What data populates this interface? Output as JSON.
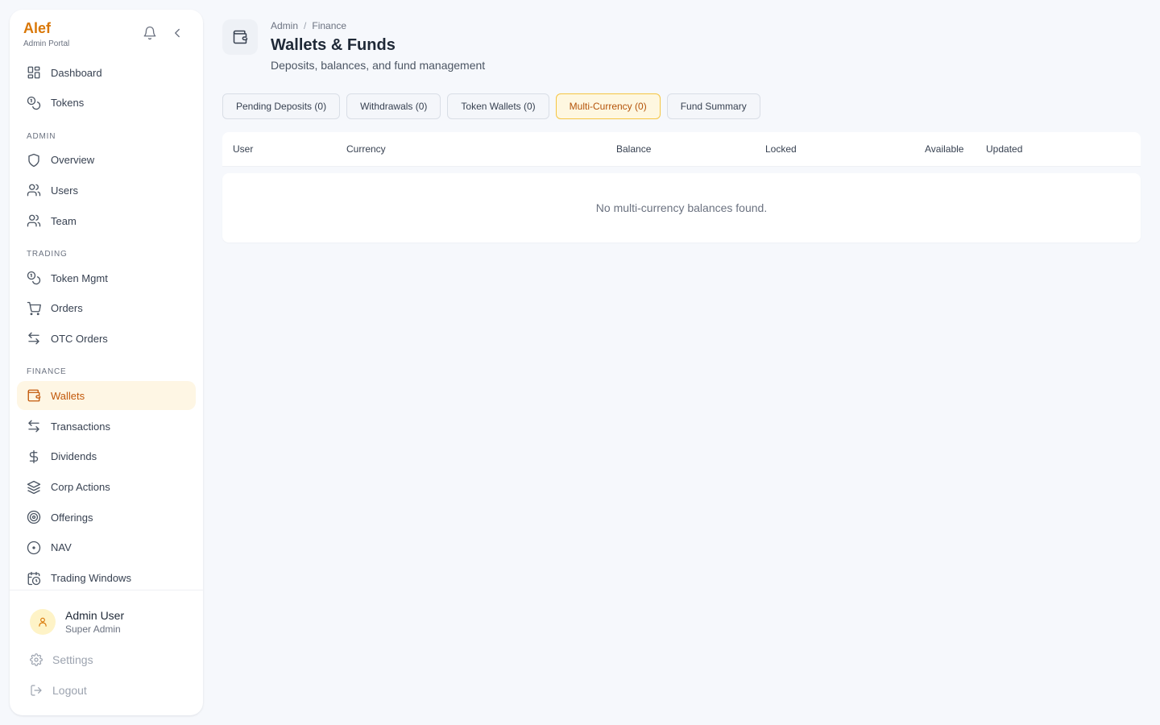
{
  "brand": {
    "name": "Alef",
    "subtitle": "Admin Portal"
  },
  "top_icons": {
    "notifications": "bell-icon",
    "collapse": "chevron-left-icon"
  },
  "nav": {
    "main": [
      {
        "label": "Dashboard",
        "icon": "dashboard-icon"
      },
      {
        "label": "Tokens",
        "icon": "coins-icon"
      }
    ],
    "sections": [
      {
        "label": "ADMIN",
        "items": [
          {
            "label": "Overview",
            "icon": "shield-icon"
          },
          {
            "label": "Users",
            "icon": "users-icon"
          },
          {
            "label": "Team",
            "icon": "team-icon"
          }
        ]
      },
      {
        "label": "TRADING",
        "items": [
          {
            "label": "Token Mgmt",
            "icon": "coins-icon"
          },
          {
            "label": "Orders",
            "icon": "cart-icon"
          },
          {
            "label": "OTC Orders",
            "icon": "arrows-icon"
          }
        ]
      },
      {
        "label": "FINANCE",
        "items": [
          {
            "label": "Wallets",
            "icon": "wallet-icon",
            "active": true
          },
          {
            "label": "Transactions",
            "icon": "arrows-icon"
          },
          {
            "label": "Dividends",
            "icon": "dollar-icon"
          },
          {
            "label": "Corp Actions",
            "icon": "layers-icon"
          },
          {
            "label": "Offerings",
            "icon": "target-icon"
          },
          {
            "label": "NAV",
            "icon": "circle-dot-icon"
          },
          {
            "label": "Trading Windows",
            "icon": "calendar-clock-icon"
          }
        ]
      }
    ]
  },
  "user": {
    "name": "Admin User",
    "role": "Super Admin"
  },
  "footer": {
    "settings": "Settings",
    "logout": "Logout"
  },
  "header": {
    "breadcrumb": [
      "Admin",
      "Finance"
    ],
    "title": "Wallets & Funds",
    "subtitle": "Deposits, balances, and fund management"
  },
  "tabs": [
    {
      "label": "Pending Deposits (0)"
    },
    {
      "label": "Withdrawals (0)"
    },
    {
      "label": "Token Wallets (0)"
    },
    {
      "label": "Multi-Currency (0)",
      "active": true
    },
    {
      "label": "Fund Summary"
    }
  ],
  "table": {
    "columns": [
      "User",
      "Currency",
      "Balance",
      "Locked",
      "Available",
      "Updated"
    ],
    "empty_message": "No multi-currency balances found."
  },
  "colors": {
    "accent": "#d97706",
    "active_bg": "#fef6e4",
    "background": "#f6f8fc"
  }
}
